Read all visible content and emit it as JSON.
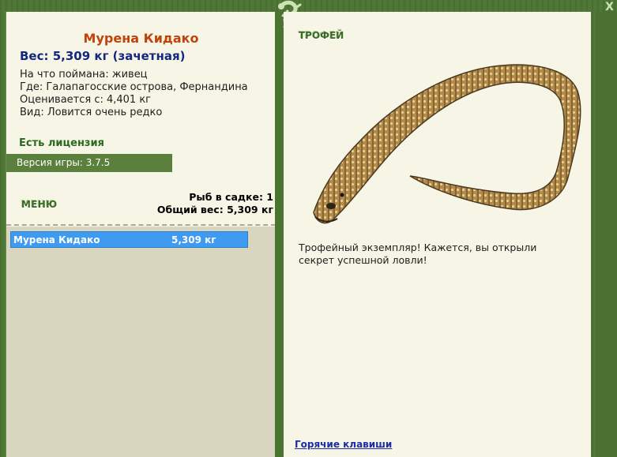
{
  "fish": {
    "name": "Мурена Кидако",
    "weight_line": "Вес: 5,309 кг (зачетная)",
    "bait_line": "На что поймана: живец",
    "location_line": "Где: Галапагосские острова, Фернандина",
    "value_line": "Оценивается с: 4,401 кг",
    "rarity_line": "Вид: Ловится очень редко"
  },
  "license": "Есть лицензия",
  "version": "Версия игры: 3.7.5",
  "menu_label": "МЕНЮ",
  "stats": {
    "count_line": "Рыб в садке: 1",
    "total_line": "Общий вес: 5,309 кг"
  },
  "catch_list": [
    {
      "name": "Мурена Кидако",
      "weight": "5,309 кг"
    }
  ],
  "trophy": {
    "label": "ТРОФЕЙ",
    "message": "Трофейный экземпляр! Кажется, вы открыли секрет успешной ловли!"
  },
  "hotkeys_label": "Горячие клавиши",
  "close_label": "X",
  "colors": {
    "frame": "#4f7735",
    "panel": "#f7f5e5",
    "title": "#c0430c",
    "weight": "#13287e",
    "selection": "#3f9bf2"
  }
}
